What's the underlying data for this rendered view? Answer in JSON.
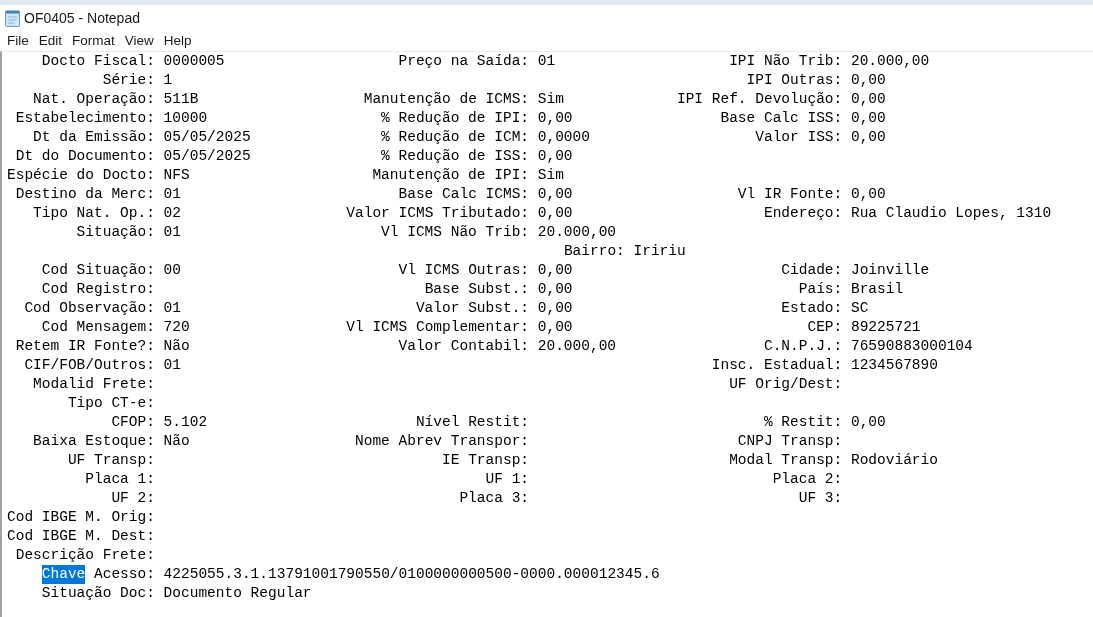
{
  "window": {
    "title": "OF0405 - Notepad"
  },
  "menu": [
    "File",
    "Edit",
    "Format",
    "View",
    "Help"
  ],
  "document": {
    "lines": [
      {
        "kind": "fields",
        "col1": {
          "label": "Docto Fiscal:",
          "value": "0000005"
        },
        "col2": {
          "label": "Preço na Saída:",
          "value": "01"
        },
        "col3": {
          "label": "IPI Não Trib:",
          "value": "20.000,00"
        }
      },
      {
        "kind": "fields",
        "col1": {
          "label": "Série:",
          "value": "1"
        },
        "col3": {
          "label": "IPI Outras:",
          "value": "0,00"
        }
      },
      {
        "kind": "fields",
        "col1": {
          "label": "Nat. Operação:",
          "value": "511B"
        },
        "col2": {
          "label": "Manutenção de ICMS:",
          "value": "Sim"
        },
        "col3": {
          "label": "IPI Ref. Devolução:",
          "value": "0,00"
        }
      },
      {
        "kind": "fields",
        "col1": {
          "label": "Estabelecimento:",
          "value": "10000"
        },
        "col2": {
          "label": "% Redução de IPI:",
          "value": "0,00"
        },
        "col3": {
          "label": "Base Calc ISS:",
          "value": "0,00"
        }
      },
      {
        "kind": "fields",
        "col1": {
          "label": "Dt da Emissão:",
          "value": "05/05/2025"
        },
        "col2": {
          "label": "% Redução de ICM:",
          "value": "0,0000"
        },
        "col3": {
          "label": "Valor ISS:",
          "value": "0,00"
        }
      },
      {
        "kind": "fields",
        "col1": {
          "label": "Dt do Documento:",
          "value": "05/05/2025"
        },
        "col2": {
          "label": "% Redução de ISS:",
          "value": "0,00"
        }
      },
      {
        "kind": "fields",
        "col1": {
          "label": "Espécie do Docto:",
          "value": "NFS"
        },
        "col2": {
          "label": "Manutenção de IPI:",
          "value": "Sim"
        }
      },
      {
        "kind": "fields",
        "col1": {
          "label": "Destino da Merc:",
          "value": "01"
        },
        "col2": {
          "label": "Base Calc ICMS:",
          "value": "0,00"
        },
        "col3": {
          "label": "Vl IR Fonte:",
          "value": "0,00"
        }
      },
      {
        "kind": "fields",
        "col1": {
          "label": "Tipo Nat. Op.:",
          "value": "02"
        },
        "col2": {
          "label": "Valor ICMS Tributado:",
          "value": "0,00"
        },
        "col3": {
          "label": "Endereço:",
          "value": "Rua Claudio Lopes, 1310"
        }
      },
      {
        "kind": "fields",
        "col1": {
          "label": "Situação:",
          "value": "01"
        },
        "col2": {
          "label": "Vl ICMS Não Trib:",
          "value": "20.000,00"
        }
      },
      {
        "kind": "continuation",
        "field": {
          "label": "Bairro:",
          "value": "Iririu"
        }
      },
      {
        "kind": "fields",
        "col1": {
          "label": "Cod Situação:",
          "value": "00"
        },
        "col2": {
          "label": "Vl ICMS Outras:",
          "value": "0,00"
        },
        "col3": {
          "label": "Cidade:",
          "value": "Joinville"
        }
      },
      {
        "kind": "fields",
        "col1": {
          "label": "Cod Registro:"
        },
        "col2": {
          "label": "Base Subst.:",
          "value": "0,00"
        },
        "col3": {
          "label": "País:",
          "value": "Brasil"
        }
      },
      {
        "kind": "fields",
        "col1": {
          "label": "Cod Observação:",
          "value": "01"
        },
        "col2": {
          "label": "Valor Subst.:",
          "value": "0,00"
        },
        "col3": {
          "label": "Estado:",
          "value": "SC"
        }
      },
      {
        "kind": "fields",
        "col1": {
          "label": "Cod Mensagem:",
          "value": "720"
        },
        "col2": {
          "label": "Vl ICMS Complementar:",
          "value": "0,00"
        },
        "col3": {
          "label": "CEP:",
          "value": "89225721"
        }
      },
      {
        "kind": "fields",
        "col1": {
          "label": "Retem IR Fonte?:",
          "value": "Não"
        },
        "col2": {
          "label": "Valor Contabil:",
          "value": "20.000,00"
        },
        "col3": {
          "label": "C.N.P.J.:",
          "value": "76590883000104"
        }
      },
      {
        "kind": "fields",
        "col1": {
          "label": "CIF/FOB/Outros:",
          "value": "01"
        },
        "col3": {
          "label": "Insc. Estadual:",
          "value": "1234567890"
        }
      },
      {
        "kind": "fields",
        "col1": {
          "label": "Modalid Frete:"
        },
        "col3": {
          "label": "UF Orig/Dest:"
        }
      },
      {
        "kind": "fields",
        "col1": {
          "label": "Tipo CT-e:"
        }
      },
      {
        "kind": "fields",
        "col1": {
          "label": "CFOP:",
          "value": "5.102"
        },
        "col2": {
          "label": "Nível Restit:"
        },
        "col3": {
          "label": "% Restit:",
          "value": "0,00"
        }
      },
      {
        "kind": "fields",
        "col1": {
          "label": "Baixa Estoque:",
          "value": "Não"
        },
        "col2": {
          "label": "Nome Abrev Transpor:"
        },
        "col3": {
          "label": "CNPJ Transp:"
        }
      },
      {
        "kind": "fields",
        "col1": {
          "label": "UF Transp:"
        },
        "col2": {
          "label": "IE Transp:"
        },
        "col3": {
          "label": "Modal Transp:",
          "value": "Rodoviário"
        }
      },
      {
        "kind": "fields",
        "col1": {
          "label": "Placa 1:"
        },
        "col2": {
          "label": "UF 1:"
        },
        "col3": {
          "label": "Placa 2:"
        }
      },
      {
        "kind": "fields",
        "col1": {
          "label": "UF 2:"
        },
        "col2": {
          "label": "Placa 3:"
        },
        "col3": {
          "label": "UF 3:"
        }
      },
      {
        "kind": "fields",
        "col1": {
          "label": "Cod IBGE M. Orig:"
        }
      },
      {
        "kind": "fields",
        "col1": {
          "label": "Cod IBGE M. Dest:"
        }
      },
      {
        "kind": "fields",
        "col1": {
          "label": "Descrição Frete:"
        }
      },
      {
        "kind": "fields",
        "col1": {
          "segments": [
            {
              "text": "Chave",
              "selected": true
            },
            {
              "text": "Acesso:",
              "selected": false
            }
          ],
          "value": "4225055.3.1.13791001790550/0100000000500-0000.000012345.6"
        }
      },
      {
        "kind": "fields",
        "col1": {
          "label": "Situação Doc:",
          "value": "Documento Regular"
        }
      }
    ]
  }
}
